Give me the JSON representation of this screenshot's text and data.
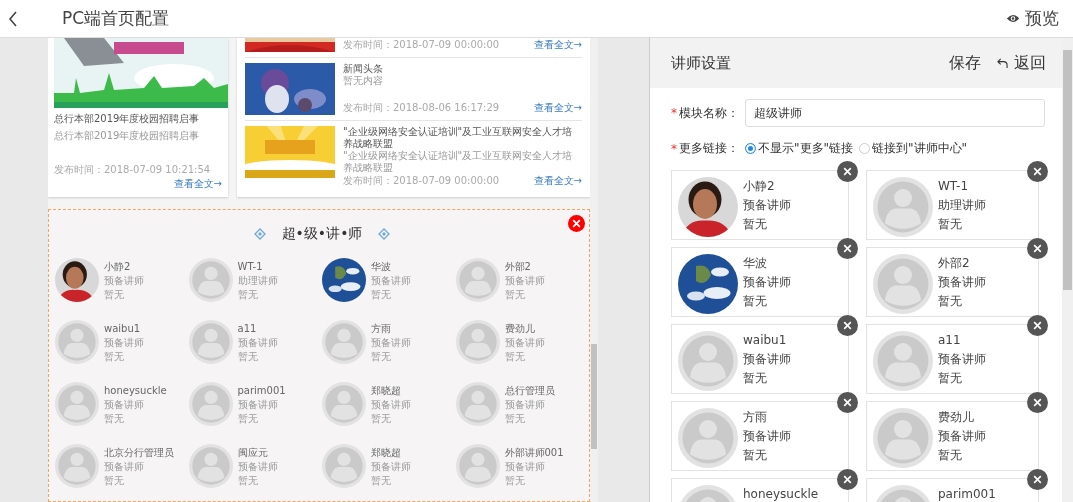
{
  "header": {
    "title": "PC端首页配置",
    "preview": "预览"
  },
  "preview": {
    "news": {
      "featured": {
        "title": "总行本部2019年度校园招聘启事",
        "summary": "总行本部2019年度校园招聘启事",
        "date": "发布时间：2018-07-09 10:21:54",
        "more": "查看全文→"
      },
      "items": [
        {
          "kind": "red",
          "date": "发布时间：2018-07-09 00:00:00",
          "more": "查看全文→"
        },
        {
          "kind": "blue",
          "title": "新闻头条",
          "summary": "暂无内容",
          "date": "发布时间：2018-08-06 16:17:29",
          "more": "查看全文→"
        },
        {
          "kind": "yellow",
          "title": "\"企业级网络安全认证培训\"及工业互联网安全人才培养战略联盟",
          "summary": "\"企业级网络安全认证培训\"及工业互联网安全人才培养战略联盟",
          "date": "发布时间：2018-07-09 00:00:00",
          "more": "查看全文→"
        }
      ]
    },
    "lecturers": {
      "title": "超•级•讲•师",
      "items": [
        {
          "name": "小静2",
          "role": "预备讲师",
          "note": "暂无",
          "kind": "person"
        },
        {
          "name": "WT-1",
          "role": "助理讲师",
          "note": "暂无",
          "kind": "default"
        },
        {
          "name": "华波",
          "role": "预备讲师",
          "note": "暂无",
          "kind": "earth"
        },
        {
          "name": "外部2",
          "role": "预备讲师",
          "note": "暂无",
          "kind": "default"
        },
        {
          "name": "waibu1",
          "role": "预备讲师",
          "note": "暂无",
          "kind": "default"
        },
        {
          "name": "a11",
          "role": "预备讲师",
          "note": "暂无",
          "kind": "default"
        },
        {
          "name": "方雨",
          "role": "预备讲师",
          "note": "暂无",
          "kind": "default"
        },
        {
          "name": "费劲儿",
          "role": "预备讲师",
          "note": "暂无",
          "kind": "default"
        },
        {
          "name": "honeysuckle",
          "role": "预备讲师",
          "note": "暂无",
          "kind": "default"
        },
        {
          "name": "parim001",
          "role": "预备讲师",
          "note": "暂无",
          "kind": "default"
        },
        {
          "name": "郑晓超",
          "role": "预备讲师",
          "note": "暂无",
          "kind": "default"
        },
        {
          "name": "总行管理员",
          "role": "预备讲师",
          "note": "暂无",
          "kind": "default"
        },
        {
          "name": "北京分行管理员",
          "role": "预备讲师",
          "note": "暂无",
          "kind": "default"
        },
        {
          "name": "闽应元",
          "role": "预备讲师",
          "note": "暂无",
          "kind": "default"
        },
        {
          "name": "郑晓超",
          "role": "预备讲师",
          "note": "暂无",
          "kind": "default"
        },
        {
          "name": "外部讲师001",
          "role": "预备讲师",
          "note": "暂无",
          "kind": "default"
        }
      ]
    }
  },
  "settings": {
    "title": "讲师设置",
    "save": "保存",
    "back": "返回",
    "name_mark": "*",
    "name_label": "模块名称：",
    "name_value": "超级讲师",
    "link_mark": "*",
    "link_label": "更多链接：",
    "link_options": [
      {
        "label": "不显示\"更多\"链接",
        "selected": true
      },
      {
        "label": "链接到\"讲师中心\"",
        "selected": false
      }
    ],
    "lecturers": [
      {
        "name": "小静2",
        "role": "预备讲师",
        "note": "暂无",
        "kind": "person"
      },
      {
        "name": "WT-1",
        "role": "助理讲师",
        "note": "暂无",
        "kind": "default"
      },
      {
        "name": "华波",
        "role": "预备讲师",
        "note": "暂无",
        "kind": "earth"
      },
      {
        "name": "外部2",
        "role": "预备讲师",
        "note": "暂无",
        "kind": "default"
      },
      {
        "name": "waibu1",
        "role": "预备讲师",
        "note": "暂无",
        "kind": "default"
      },
      {
        "name": "a11",
        "role": "预备讲师",
        "note": "暂无",
        "kind": "default"
      },
      {
        "name": "方雨",
        "role": "预备讲师",
        "note": "暂无",
        "kind": "default"
      },
      {
        "name": "费劲儿",
        "role": "预备讲师",
        "note": "暂无",
        "kind": "default"
      },
      {
        "name": "honeysuckle",
        "kind": "default"
      },
      {
        "name": "parim001",
        "kind": "default"
      }
    ]
  }
}
